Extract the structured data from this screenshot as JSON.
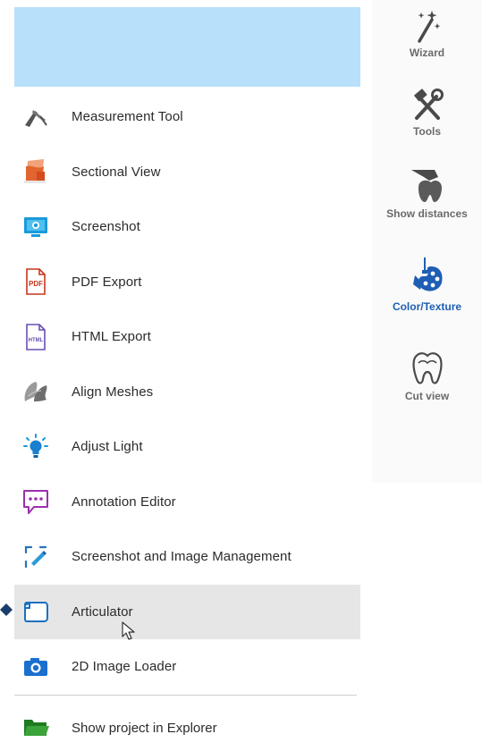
{
  "menu": {
    "items": [
      {
        "label": "Measurement Tool",
        "icon": "caliper-icon"
      },
      {
        "label": "Sectional View",
        "icon": "sectional-view-icon"
      },
      {
        "label": "Screenshot",
        "icon": "screenshot-monitor-icon"
      },
      {
        "label": "PDF Export",
        "icon": "pdf-file-icon"
      },
      {
        "label": "HTML Export",
        "icon": "html-file-icon"
      },
      {
        "label": "Align Meshes",
        "icon": "align-meshes-icon"
      },
      {
        "label": "Adjust Light",
        "icon": "lightbulb-icon"
      },
      {
        "label": "Annotation Editor",
        "icon": "annotation-bubble-icon"
      },
      {
        "label": "Screenshot and Image Management",
        "icon": "image-management-icon"
      },
      {
        "label": "Articulator",
        "icon": "articulator-icon",
        "selected": true
      },
      {
        "label": "2D Image Loader",
        "icon": "camera-icon"
      }
    ],
    "bottom": {
      "label": "Show project in Explorer",
      "icon": "folder-open-icon"
    }
  },
  "toolbar": {
    "items": [
      {
        "label": "Wizard",
        "icon": "magic-wand-icon"
      },
      {
        "label": "Tools",
        "icon": "hammer-wrench-icon"
      },
      {
        "label": "Show distances",
        "icon": "tooth-distances-icon"
      },
      {
        "label": "Color/Texture",
        "icon": "palette-brush-icon",
        "active": true
      },
      {
        "label": "Cut view",
        "icon": "tooth-outline-icon"
      }
    ]
  },
  "colors": {
    "header_band": "#b8e0fa",
    "selected_row": "#e6e6e6",
    "active_tool": "#1e5fb4"
  }
}
